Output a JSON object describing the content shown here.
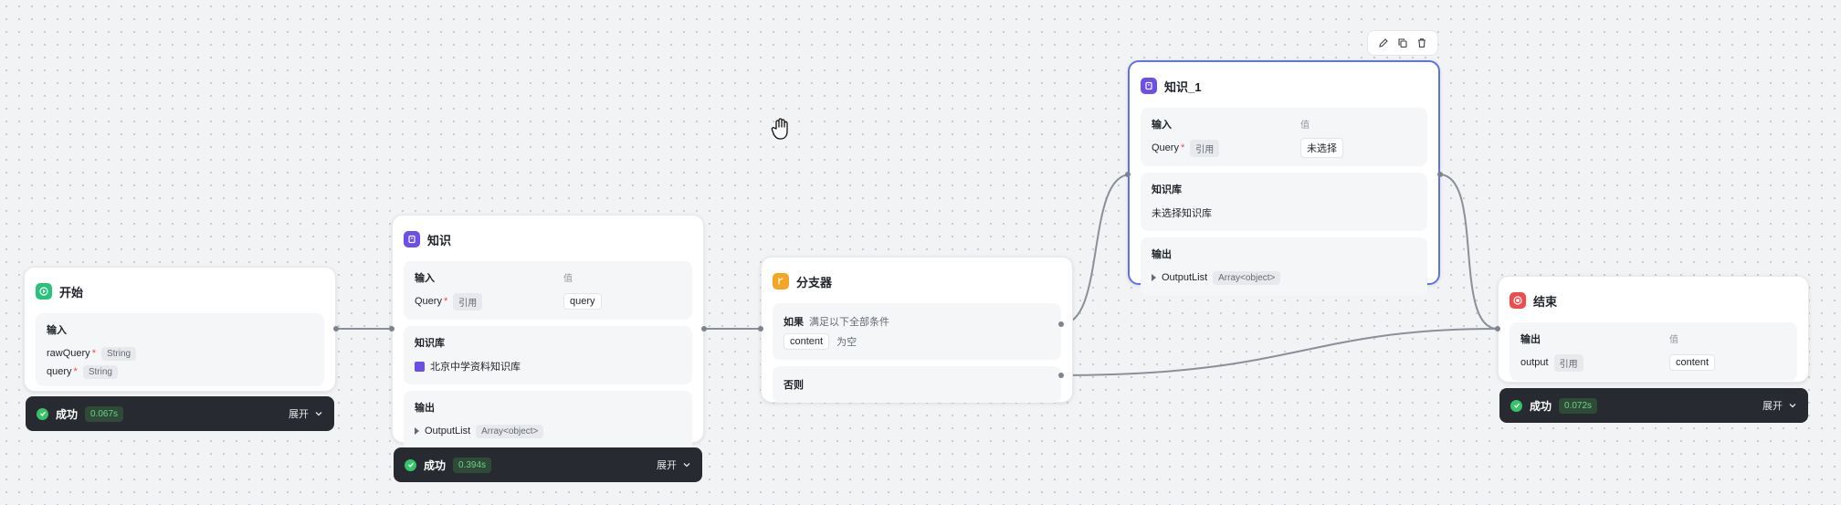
{
  "toolbar": {
    "edit_icon": "pencil-icon",
    "copy_icon": "copy-icon",
    "delete_icon": "trash-icon"
  },
  "cursor": {
    "icon": "hand-cursor-icon"
  },
  "colors": {
    "selected_border": "#5b73e8",
    "success": "#35c46a",
    "start": "#28c27a",
    "knowledge": "#6c4ee8",
    "branch": "#f5a524",
    "end": "#ef4d4d"
  },
  "start": {
    "title": "开始",
    "input_title": "输入",
    "params": [
      {
        "name": "rawQuery",
        "type": "String"
      },
      {
        "name": "query",
        "type": "String"
      }
    ],
    "status": {
      "label": "成功",
      "time": "0.067s",
      "expand": "展开"
    }
  },
  "knowledge": {
    "title": "知识",
    "input_title": "输入",
    "value_header": "值",
    "param_name": "Query",
    "param_ref": "引用",
    "param_value": "query",
    "kb_title": "知识库",
    "kb_name": "北京中学资料知识库",
    "output_title": "输出",
    "output_name": "OutputList",
    "output_type": "Array<object>",
    "status": {
      "label": "成功",
      "time": "0.394s",
      "expand": "展开"
    }
  },
  "branch": {
    "title": "分支器",
    "if_label": "如果",
    "if_condition": "满足以下全部条件",
    "cond_field": "content",
    "cond_op": "为空",
    "else_label": "否则"
  },
  "knowledge1": {
    "title": "知识_1",
    "input_title": "输入",
    "value_header": "值",
    "param_name": "Query",
    "param_ref": "引用",
    "param_value": "未选择",
    "kb_title": "知识库",
    "kb_empty": "未选择知识库",
    "output_title": "输出",
    "output_name": "OutputList",
    "output_type": "Array<object>"
  },
  "end": {
    "title": "结束",
    "output_title": "输出",
    "value_header": "值",
    "param_name": "output",
    "param_ref": "引用",
    "param_value": "content",
    "status": {
      "label": "成功",
      "time": "0.072s",
      "expand": "展开"
    }
  }
}
